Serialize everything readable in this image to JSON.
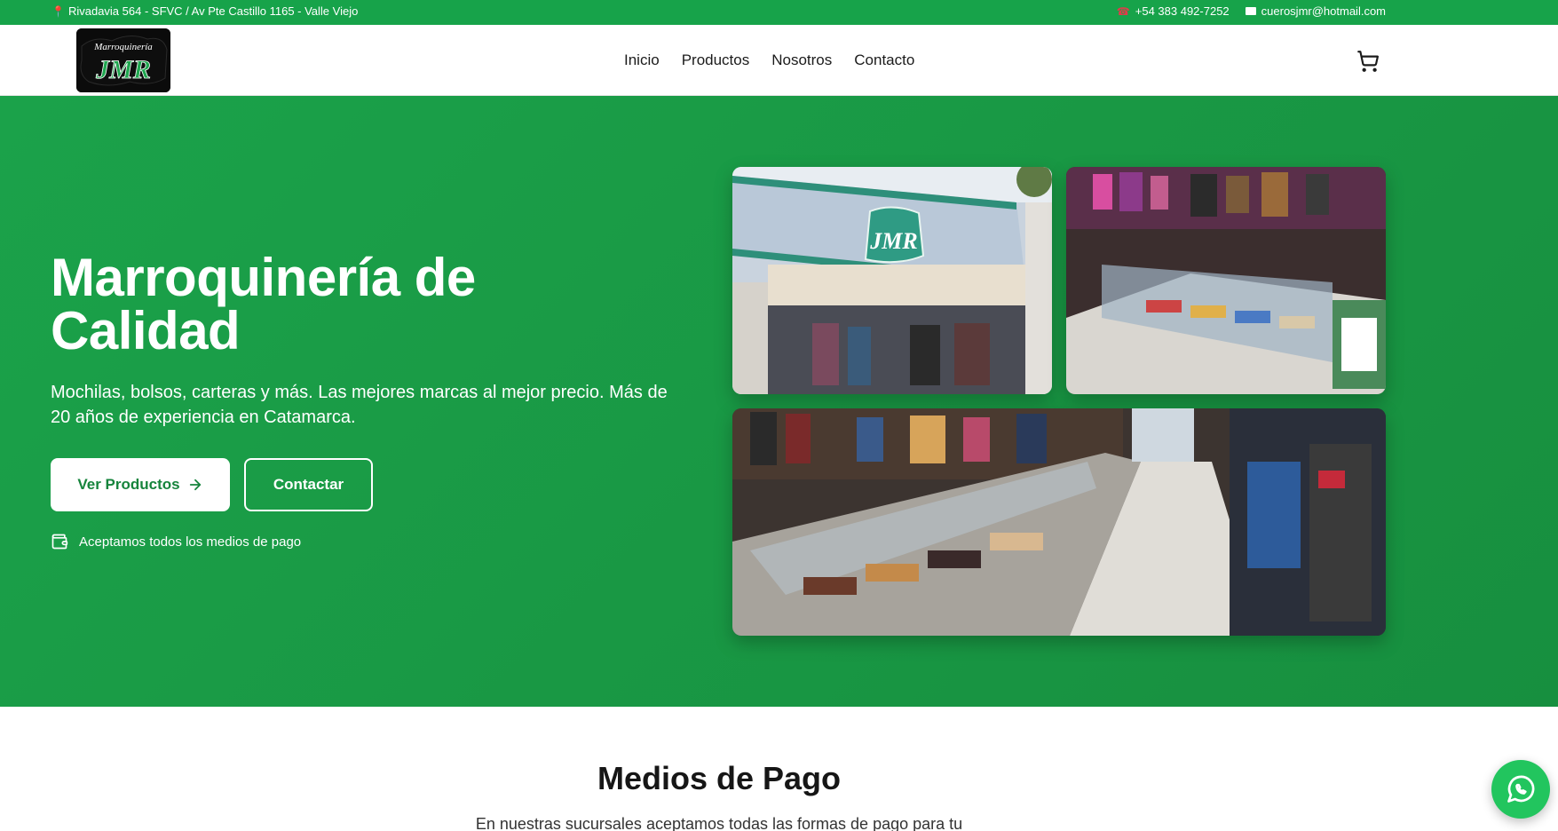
{
  "topbar": {
    "address": "Rivadavia 564 - SFVC / Av Pte Castillo 1165 - Valle Viejo",
    "phone": "+54 383 492-7252",
    "email": "cuerosjmr@hotmail.com"
  },
  "logo": {
    "line1": "Marroquinería",
    "line2": "JMR"
  },
  "nav": {
    "items": [
      "Inicio",
      "Productos",
      "Nosotros",
      "Contacto"
    ]
  },
  "hero": {
    "title": "Marroquinería de Calidad",
    "subtitle": "Mochilas, bolsos, carteras y más. Las mejores marcas al mejor precio. Más de 20 años de experiencia en Catamarca.",
    "primary_button": "Ver Productos",
    "secondary_button": "Contactar",
    "payment_note": "Aceptamos todos los medios de pago"
  },
  "payments": {
    "title": "Medios de Pago",
    "subtitle": "En nuestras sucursales aceptamos todas las formas de pago para tu"
  },
  "colors": {
    "brand_green": "#17a34a",
    "whatsapp_green": "#22c55e"
  }
}
